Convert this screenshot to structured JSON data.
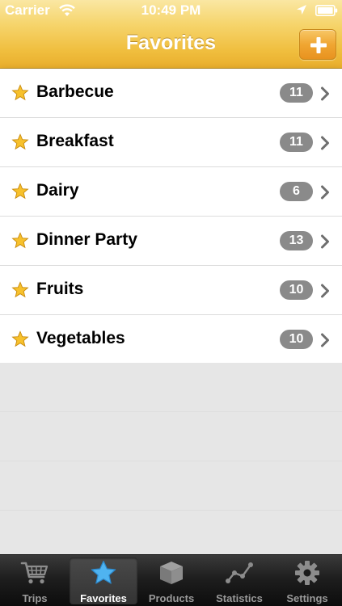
{
  "status_bar": {
    "carrier": "Carrier",
    "time": "10:49 PM",
    "icons": [
      "wifi-icon",
      "location-icon",
      "battery-icon"
    ]
  },
  "nav": {
    "title": "Favorites",
    "add_button_icon": "plus-icon"
  },
  "favorites": [
    {
      "label": "Barbecue",
      "count": "11"
    },
    {
      "label": "Breakfast",
      "count": "11"
    },
    {
      "label": "Dairy",
      "count": "6"
    },
    {
      "label": "Dinner Party",
      "count": "13"
    },
    {
      "label": "Fruits",
      "count": "10"
    },
    {
      "label": "Vegetables",
      "count": "10"
    }
  ],
  "tabs": [
    {
      "label": "Trips",
      "icon": "cart-icon",
      "active": false
    },
    {
      "label": "Favorites",
      "icon": "star-icon",
      "active": true
    },
    {
      "label": "Products",
      "icon": "box-icon",
      "active": false
    },
    {
      "label": "Statistics",
      "icon": "graph-icon",
      "active": false
    },
    {
      "label": "Settings",
      "icon": "gear-icon",
      "active": false
    }
  ],
  "colors": {
    "nav_gold": "#f0be3e",
    "add_button_orange": "#f0a632",
    "badge_gray": "#8a8a8a",
    "tab_active_blue": "#4fb3f0",
    "star_gold": "#f7c12c"
  }
}
